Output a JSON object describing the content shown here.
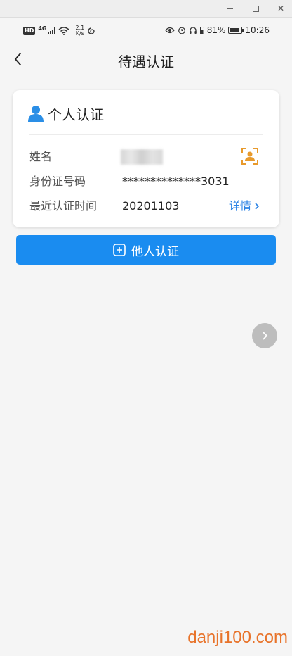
{
  "status_bar": {
    "hd_label": "HD",
    "network_label": "4G",
    "speed_value": "2.1",
    "speed_unit": "K/s",
    "battery_percent": "81%",
    "battery_level": 0.81,
    "time": "10:26"
  },
  "header": {
    "title": "待遇认证"
  },
  "card": {
    "title": "个人认证",
    "rows": [
      {
        "label": "姓名",
        "value": ""
      },
      {
        "label": "身份证号码",
        "value": "**************3031"
      },
      {
        "label": "最近认证时间",
        "value": "20201103"
      }
    ],
    "detail_label": "详情"
  },
  "other_auth_button": {
    "label": "他人认证"
  },
  "watermark": "danji100.com",
  "colors": {
    "primary": "#1a8cf0",
    "link": "#2a82e4",
    "accent_orange": "#e89a2c",
    "user_icon": "#2a8ee6"
  },
  "icons": {
    "back": "chevron-left-icon",
    "user": "user-icon",
    "face_scan": "face-scan-icon",
    "add": "plus-square-icon",
    "next": "chevron-right-icon"
  }
}
